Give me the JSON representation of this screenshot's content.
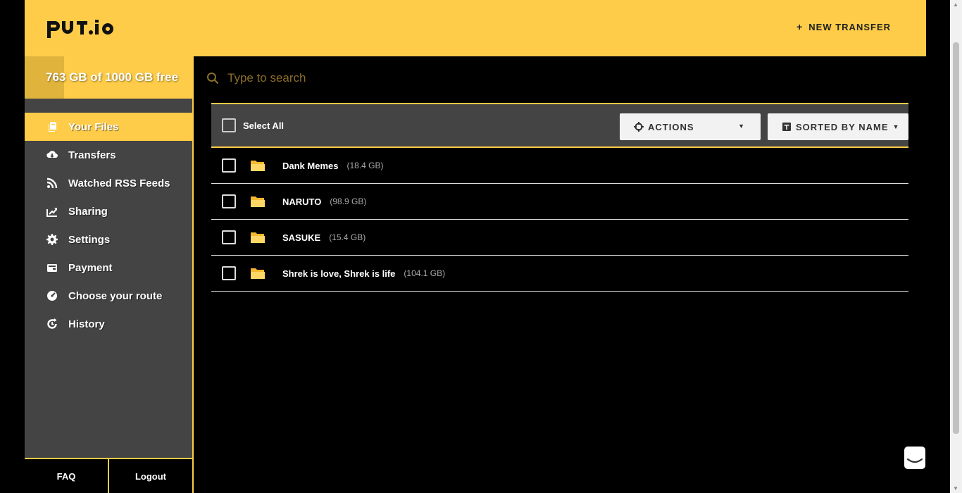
{
  "brand": {
    "logo_text": "put.io",
    "accent_color": "#fecc48"
  },
  "header": {
    "new_transfer_label": "NEW TRANSFER",
    "new_transfer_icon": "plus-icon"
  },
  "storage": {
    "label": "763 GB of 1000 GB free",
    "used_fraction": 0.237
  },
  "sidebar": {
    "items": [
      {
        "label": "Your Files",
        "icon": "files-icon",
        "active": true
      },
      {
        "label": "Transfers",
        "icon": "cloud-download-icon",
        "active": false
      },
      {
        "label": "Watched RSS Feeds",
        "icon": "rss-icon",
        "active": false
      },
      {
        "label": "Sharing",
        "icon": "share-icon",
        "active": false
      },
      {
        "label": "Settings",
        "icon": "gear-icon",
        "active": false
      },
      {
        "label": "Payment",
        "icon": "wallet-icon",
        "active": false
      },
      {
        "label": "Choose your route",
        "icon": "gauge-icon",
        "active": false
      },
      {
        "label": "History",
        "icon": "history-icon",
        "active": false
      }
    ],
    "footer": {
      "faq": "FAQ",
      "logout": "Logout"
    }
  },
  "search": {
    "placeholder": "Type to search",
    "value": ""
  },
  "toolbar": {
    "select_all": "Select All",
    "actions_label": "ACTIONS",
    "sort_label": "SORTED BY NAME"
  },
  "files": [
    {
      "name": "Dank Memes",
      "size": "(18.4 GB)",
      "type": "folder"
    },
    {
      "name": "NARUTO",
      "size": "(98.9 GB)",
      "type": "folder"
    },
    {
      "name": "SASUKE",
      "size": "(15.4 GB)",
      "type": "folder"
    },
    {
      "name": "Shrek is love, Shrek is life",
      "size": "(104.1 GB)",
      "type": "folder"
    }
  ]
}
